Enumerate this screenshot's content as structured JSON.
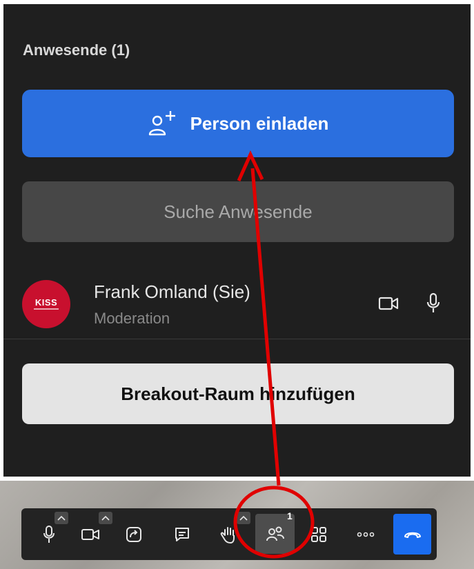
{
  "panel": {
    "title": "Anwesende (1)",
    "invite_label": "Person einladen",
    "search_placeholder": "Suche Anwesende",
    "participant": {
      "name": "Frank Omland (Sie)",
      "role": "Moderation",
      "avatar_logo": "KISS"
    },
    "breakout_label": "Breakout-Raum hinzufügen"
  },
  "toolbar": {
    "items": [
      {
        "icon": "microphone-icon"
      },
      {
        "icon": "camera-icon"
      },
      {
        "icon": "share-screen-icon"
      },
      {
        "icon": "chat-icon"
      },
      {
        "icon": "raise-hand-icon"
      },
      {
        "icon": "participants-icon",
        "badge": "1",
        "active": true
      },
      {
        "icon": "layout-grid-icon"
      },
      {
        "icon": "more-icon"
      },
      {
        "icon": "end-call-icon"
      }
    ]
  },
  "colors": {
    "panel_bg": "#1f1f1f",
    "accent": "#2b6fdf",
    "end_call": "#1a6cf0",
    "annotation": "#e00000"
  }
}
